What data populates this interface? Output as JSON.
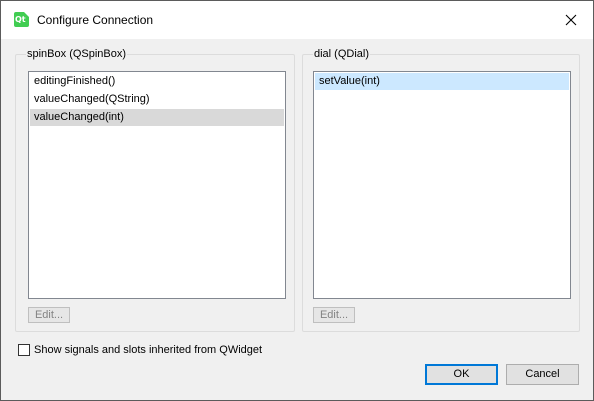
{
  "window": {
    "title": "Configure Connection",
    "icon": "qt-icon",
    "close_icon": "close-icon"
  },
  "left_group": {
    "title": "spinBox (QSpinBox)",
    "items": [
      {
        "label": "editingFinished()",
        "selected": false
      },
      {
        "label": "valueChanged(QString)",
        "selected": false
      },
      {
        "label": "valueChanged(int)",
        "selected": true
      }
    ],
    "edit_label": "Edit..."
  },
  "right_group": {
    "title": "dial (QDial)",
    "items": [
      {
        "label": "setValue(int)",
        "selected": true
      }
    ],
    "edit_label": "Edit..."
  },
  "inherited_checkbox": {
    "label": "Show signals and slots inherited from QWidget",
    "checked": false
  },
  "buttons": {
    "ok_label": "OK",
    "cancel_label": "Cancel"
  },
  "colors": {
    "selection_inactive": "#d9d9d9",
    "selection_active": "#cce8ff",
    "default_button_border": "#0078d7"
  }
}
